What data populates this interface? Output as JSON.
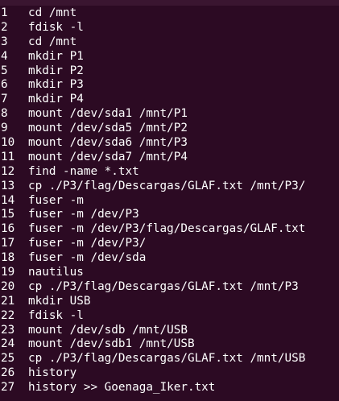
{
  "terminal": {
    "background": "#300a24",
    "foreground": "#ffffff",
    "history": [
      {
        "n": "1",
        "cmd": "cd /mnt"
      },
      {
        "n": "2",
        "cmd": "fdisk -l"
      },
      {
        "n": "3",
        "cmd": "cd /mnt"
      },
      {
        "n": "4",
        "cmd": "mkdir P1"
      },
      {
        "n": "5",
        "cmd": "mkdir P2"
      },
      {
        "n": "6",
        "cmd": "mkdir P3"
      },
      {
        "n": "7",
        "cmd": "mkdir P4"
      },
      {
        "n": "8",
        "cmd": "mount /dev/sda1 /mnt/P1"
      },
      {
        "n": "9",
        "cmd": "mount /dev/sda5 /mnt/P2"
      },
      {
        "n": "10",
        "cmd": "mount /dev/sda6 /mnt/P3"
      },
      {
        "n": "11",
        "cmd": "mount /dev/sda7 /mnt/P4"
      },
      {
        "n": "12",
        "cmd": "find -name *.txt"
      },
      {
        "n": "13",
        "cmd": "cp ./P3/flag/Descargas/GLAF.txt /mnt/P3/"
      },
      {
        "n": "14",
        "cmd": "fuser -m"
      },
      {
        "n": "15",
        "cmd": "fuser -m /dev/P3"
      },
      {
        "n": "16",
        "cmd": "fuser -m /dev/P3/flag/Descargas/GLAF.txt"
      },
      {
        "n": "17",
        "cmd": "fuser -m /dev/P3/"
      },
      {
        "n": "18",
        "cmd": "fuser -m /dev/sda"
      },
      {
        "n": "19",
        "cmd": "nautilus"
      },
      {
        "n": "20",
        "cmd": "cp ./P3/flag/Descargas/GLAF.txt /mnt/P3"
      },
      {
        "n": "21",
        "cmd": "mkdir USB"
      },
      {
        "n": "22",
        "cmd": "fdisk -l"
      },
      {
        "n": "23",
        "cmd": "mount /dev/sdb /mnt/USB"
      },
      {
        "n": "24",
        "cmd": "mount /dev/sdb1 /mnt/USB"
      },
      {
        "n": "25",
        "cmd": "cp ./P3/flag/Descargas/GLAF.txt /mnt/USB"
      },
      {
        "n": "26",
        "cmd": "history"
      },
      {
        "n": "27",
        "cmd": "history >> Goenaga_Iker.txt"
      }
    ]
  }
}
